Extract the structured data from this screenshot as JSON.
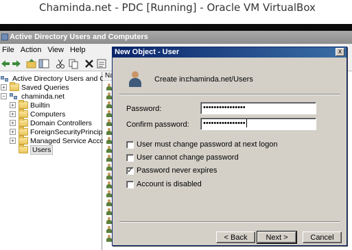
{
  "host": {
    "title": "Chaminda.net - PDC [Running] - Oracle VM VirtualBox"
  },
  "aduc": {
    "title": "Active Directory Users and Computers",
    "menu": [
      "File",
      "Action",
      "View",
      "Help"
    ],
    "tree": {
      "root": "Active Directory Users and Comput",
      "saved_queries": "Saved Queries",
      "domain": "chaminda.net",
      "children": [
        "Builtin",
        "Computers",
        "Domain Controllers",
        "ForeignSecurityPrincipals",
        "Managed Service Accounts",
        "Users"
      ]
    },
    "list": {
      "column_header": "Na"
    }
  },
  "dialog": {
    "title": "New Object - User",
    "close": "x",
    "create_in_label": "Create in:",
    "create_in_value": "chaminda.net/Users",
    "password_label": "Password:",
    "password_value": "••••••••••••••••",
    "confirm_label": "Confirm password:",
    "confirm_value": "••••••••••••••••",
    "options": [
      {
        "label": "User must change password at next logon",
        "checked": false
      },
      {
        "label": "User cannot change password",
        "checked": false
      },
      {
        "label": "Password never expires",
        "checked": true
      },
      {
        "label": "Account is disabled",
        "checked": false
      }
    ],
    "buttons": {
      "back": "< Back",
      "next": "Next >",
      "cancel": "Cancel"
    }
  }
}
